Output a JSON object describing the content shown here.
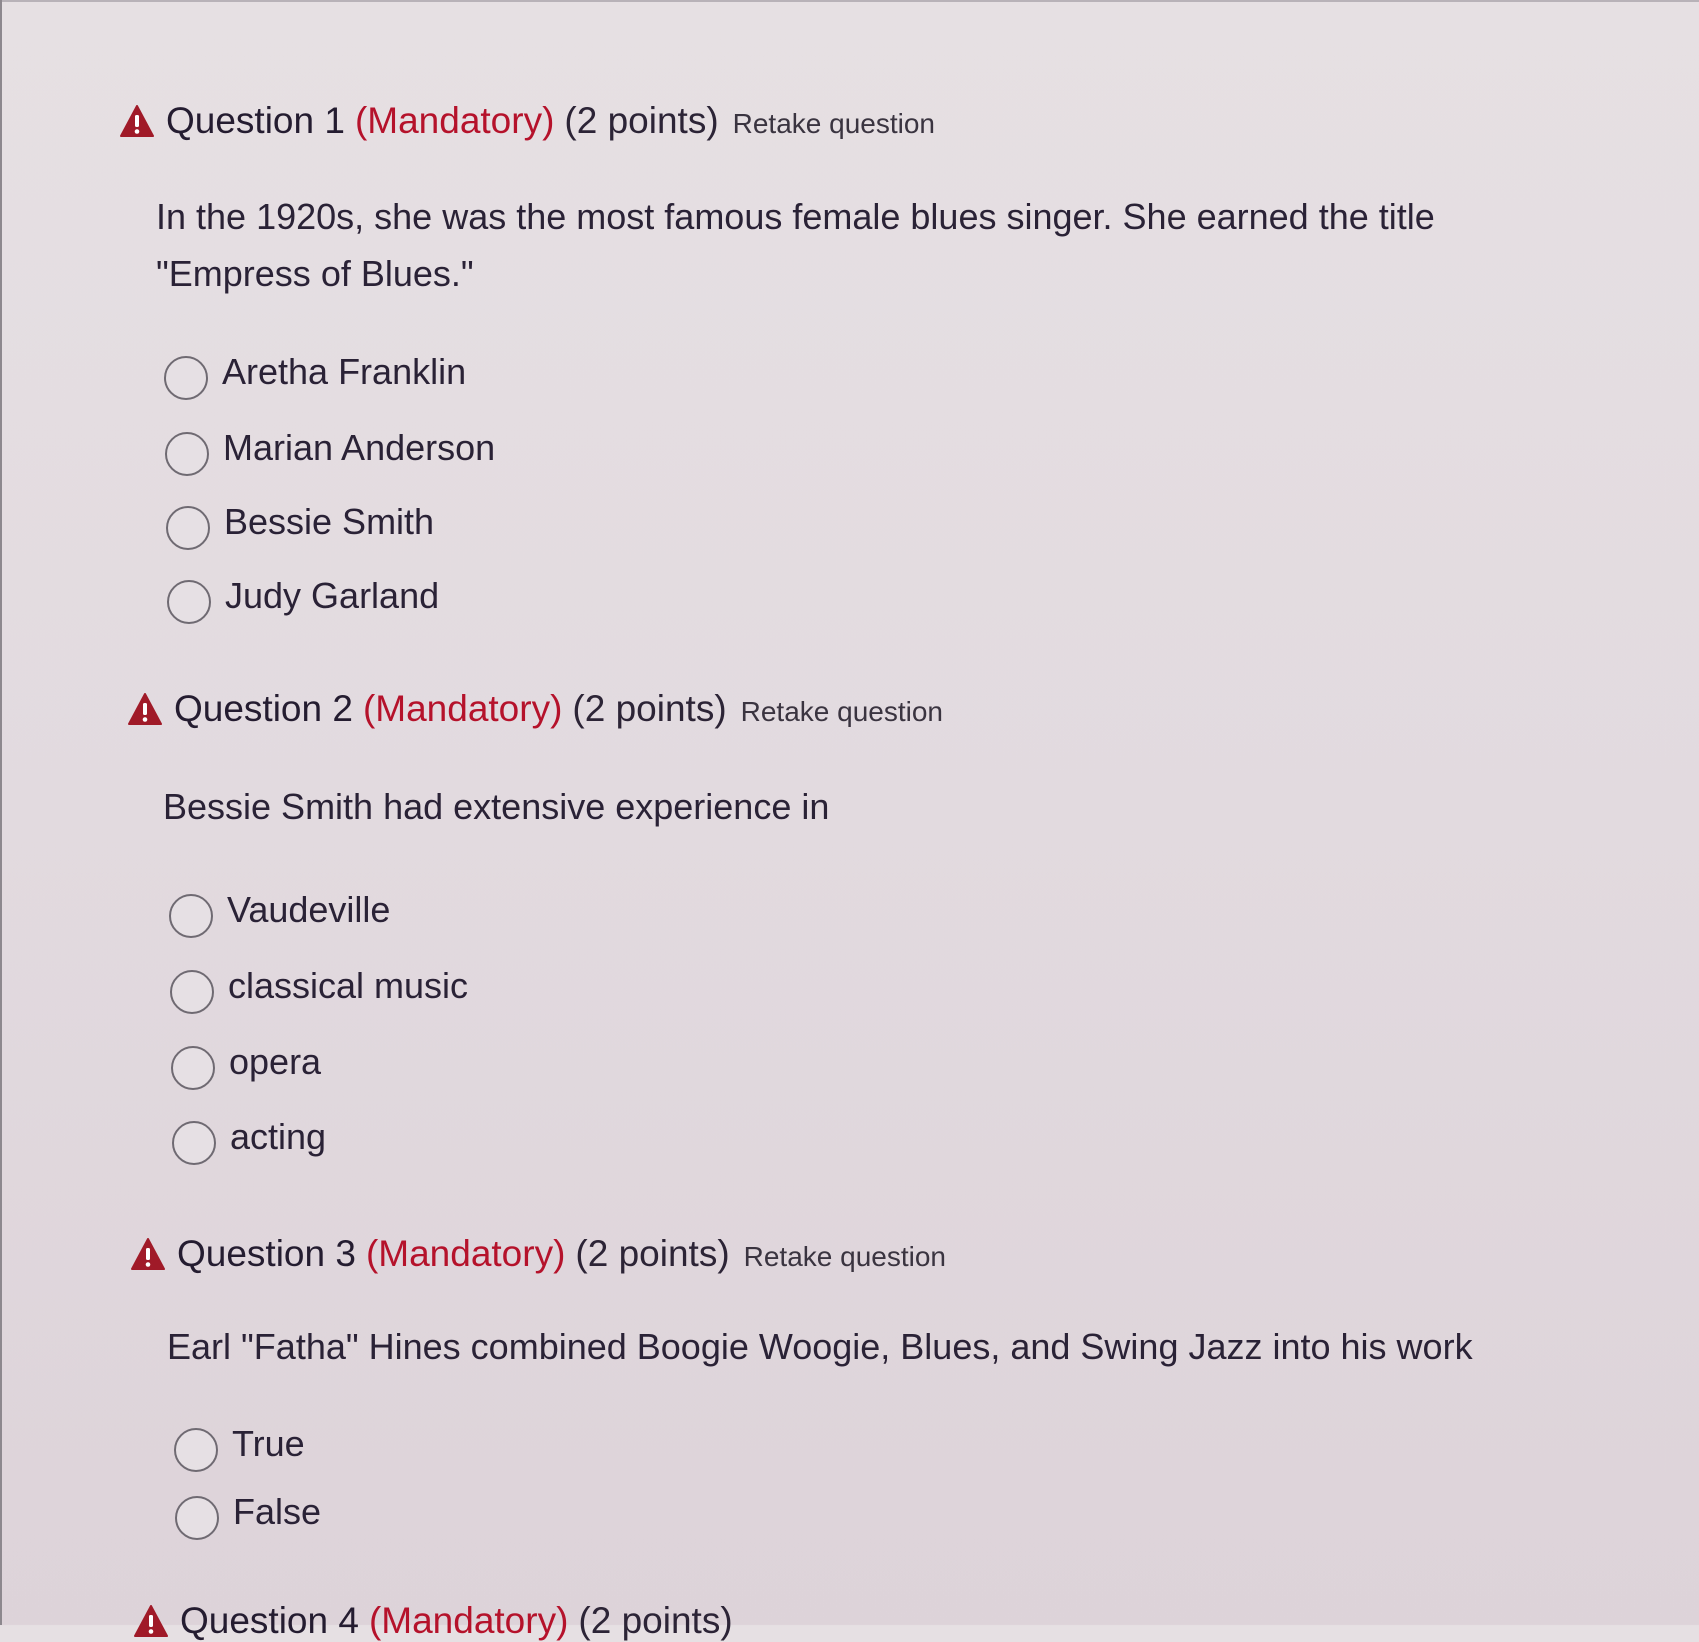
{
  "colors": {
    "mandatory": "#b5122b",
    "warning": "#a01a28",
    "text": "#2a2236"
  },
  "questions": [
    {
      "title": "Question 1",
      "mandatory": "(Mandatory)",
      "points": "(2 points)",
      "retake": "Retake question",
      "icon": "warning-triangle-icon",
      "text": "In the 1920s, she was the most famous female blues singer. She earned the title \"Empress of Blues.\"",
      "options": [
        "Aretha Franklin",
        "Marian Anderson",
        "Bessie Smith",
        "Judy Garland"
      ]
    },
    {
      "title": "Question 2",
      "mandatory": "(Mandatory)",
      "points": "(2 points)",
      "retake": "Retake question",
      "icon": "warning-triangle-icon",
      "text": "Bessie Smith had extensive experience in",
      "options": [
        "Vaudeville",
        "classical music",
        "opera",
        "acting"
      ]
    },
    {
      "title": "Question 3",
      "mandatory": "(Mandatory)",
      "points": "(2 points)",
      "retake": "Retake question",
      "icon": "warning-triangle-icon",
      "text": "Earl \"Fatha\" Hines combined Boogie Woogie, Blues, and Swing Jazz into his work",
      "options": [
        "True",
        "False"
      ]
    },
    {
      "title": "Question 4",
      "mandatory": "(Mandatory)",
      "points": "(2 points)"
    }
  ]
}
